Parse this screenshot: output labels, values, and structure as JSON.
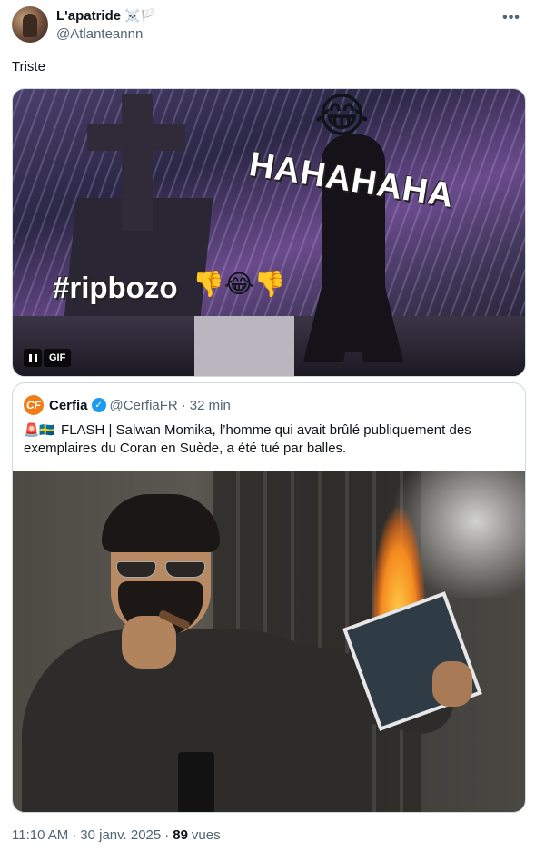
{
  "author": {
    "display_name": "L'apatride",
    "name_emojis": "☠️🏳️",
    "handle": "@Atlanteannn",
    "more_icon": "more-horizontal-icon"
  },
  "tweet": {
    "text": "Triste"
  },
  "gif": {
    "caption_haha": "HAHAHAHA",
    "caption_rip": "#ripbozo",
    "caption_rip_emojis": "👎😂👎",
    "laugh_emoji": "😂",
    "badge_label": "GIF",
    "pause_icon": "pause-icon"
  },
  "quoted": {
    "avatar_letters": "CF",
    "display_name": "Cerfia",
    "verified_icon": "verified-badge-icon",
    "handle": "@CerfiaFR",
    "separator": "·",
    "time": "32 min",
    "flag_emojis": "🚨🇸🇪",
    "text": "FLASH | Salwan Momika, l’homme qui avait brûlé publiquement des exemplaires du Coran en Suède, a été tué par balles."
  },
  "meta": {
    "time": "11:10 AM",
    "separator1": "·",
    "date": "30 janv. 2025",
    "separator2": "·",
    "views_count": "89",
    "views_label": "vues"
  }
}
